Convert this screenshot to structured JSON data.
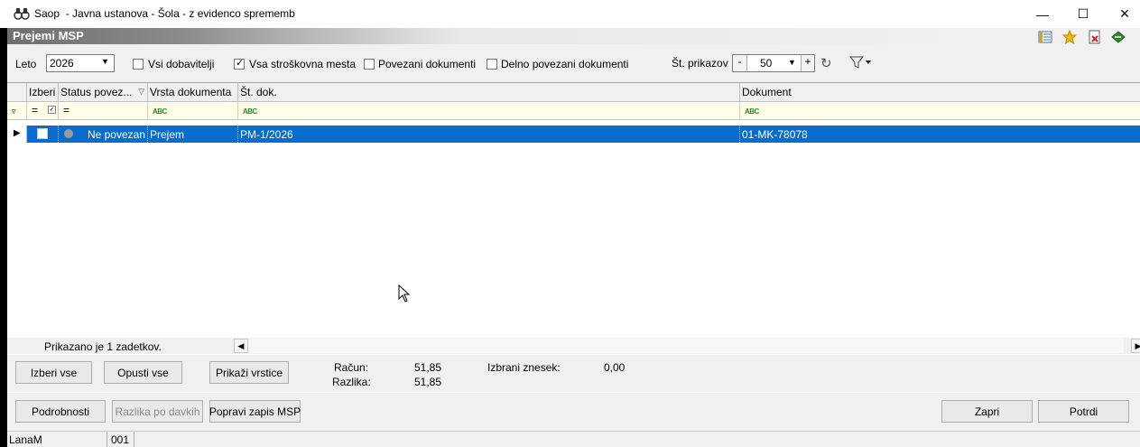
{
  "window": {
    "title": "Saop  - Javna ustanova - Šola - z evidenco sprememb",
    "minimize": "—",
    "maximize": "☐",
    "close": "✕"
  },
  "header": {
    "title": "Prejemi MSP",
    "icons": [
      "settings-list-icon",
      "favorite-star-icon",
      "delete-document-icon",
      "exit-icon"
    ]
  },
  "toolbar": {
    "year_label": "Leto",
    "year_value": "2026",
    "all_suppliers": "Vsi dobavitelji",
    "all_cost_centers": "Vsa stroškovna mesta",
    "linked_docs": "Povezani dokumenti",
    "partially_linked_docs": "Delno povezani dokumenti",
    "count_label": "Št. prikazov",
    "count_minus": "-",
    "count_value": "50",
    "count_plus": "+"
  },
  "grid": {
    "columns": [
      "Izberi",
      "Status povez...",
      "Vrsta dokumenta",
      "Št. dok.",
      "Dokument"
    ],
    "filter_eq": "=",
    "filter_abc": "ABC",
    "rows": [
      {
        "status": "Ne povezan",
        "type": "Prejem",
        "number": "PM-1/2026",
        "document": "01-MK-78078"
      }
    ],
    "footer": "Prikazano je 1 zadetkov."
  },
  "summary": {
    "invoice_label": "Račun:",
    "invoice_value": "51,85",
    "difference_label": "Razlika:",
    "difference_value": "51,85",
    "selected_label": "Izbrani znesek:",
    "selected_value": "0,00"
  },
  "buttons": {
    "select_all": "Izberi vse",
    "deselect_all": "Opusti vse",
    "show_rows": "Prikaži vrstice",
    "details": "Podrobnosti",
    "tax_difference": "Razlika po davkih",
    "fix_msp": "Popravi zapis MSP",
    "close": "Zapri",
    "confirm": "Potrdi"
  },
  "statusbar": {
    "user": "LanaM",
    "code": "001"
  }
}
